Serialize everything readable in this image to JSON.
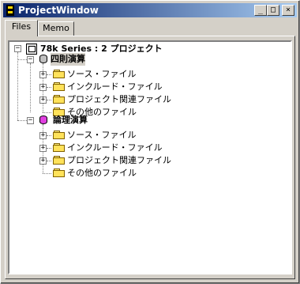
{
  "window": {
    "title": "ProjectWindow"
  },
  "titlebar_buttons": {
    "minimize": "_",
    "maximize": "□",
    "close": "×"
  },
  "tabs": [
    {
      "label": "Files"
    },
    {
      "label": "Memo"
    }
  ],
  "tree": {
    "root": {
      "label": "78k Series : 2 プロジェクト",
      "expanded": true
    },
    "projects": [
      {
        "label": "四則演算",
        "icon_color": "#c0c0c0",
        "selected": true,
        "folders": [
          {
            "label": "ソース・ファイル"
          },
          {
            "label": "インクルード・ファイル"
          },
          {
            "label": "プロジェクト関連ファイル"
          },
          {
            "label": "その他のファイル"
          }
        ]
      },
      {
        "label": "論理演算",
        "icon_color": "#e040e0",
        "selected": false,
        "folders": [
          {
            "label": "ソース・ファイル"
          },
          {
            "label": "インクルード・ファイル"
          },
          {
            "label": "プロジェクト関連ファイル"
          },
          {
            "label": "その他のファイル"
          }
        ]
      }
    ]
  }
}
